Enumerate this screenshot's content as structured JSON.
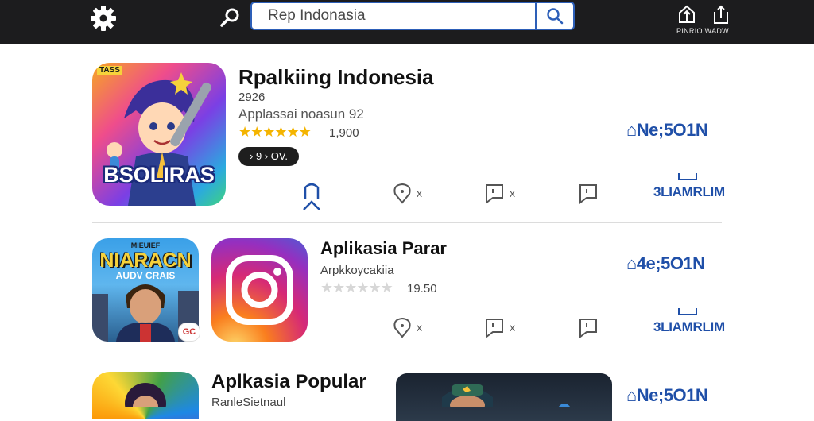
{
  "topbar": {
    "search_placeholder": "Rep Indonasia",
    "right_label": "PINRIO WADW"
  },
  "rows": [
    {
      "title": "Rpalkiing Indonesia",
      "line1": "2926",
      "line2": "Applassai noasun 92",
      "stars": "★★★★★★",
      "rating": "1,900",
      "pill": "› 9 › OV.",
      "icon_text": "BSOLIRAS",
      "icon_top_text": "TASS",
      "side_label": "⌂Ne;5O1N",
      "side_label2": "3LIAMRLIM",
      "actions": [
        "x",
        "x"
      ]
    },
    {
      "title": "Aplikasia Parar",
      "line1": "Arpkkoycakiia",
      "stars": "★★★★★★",
      "rating": "19.50",
      "icon_text": "NIARACN",
      "icon_sub_text": "AUDV CRAIS",
      "icon_top_text": "MIEUIEF",
      "badge": "GC",
      "side_label": "⌂4e;5O1N",
      "side_label2": "3LIAMRLIM",
      "actions": [
        "x",
        "x"
      ]
    },
    {
      "title": "Aplkasia Popular",
      "line1": "RanleSietnaul",
      "side_label": "⌂Ne;5O1N"
    }
  ],
  "colors": {
    "accent": "#1f4fa8",
    "topbar": "#1c1c1e",
    "star": "#f4b400"
  }
}
